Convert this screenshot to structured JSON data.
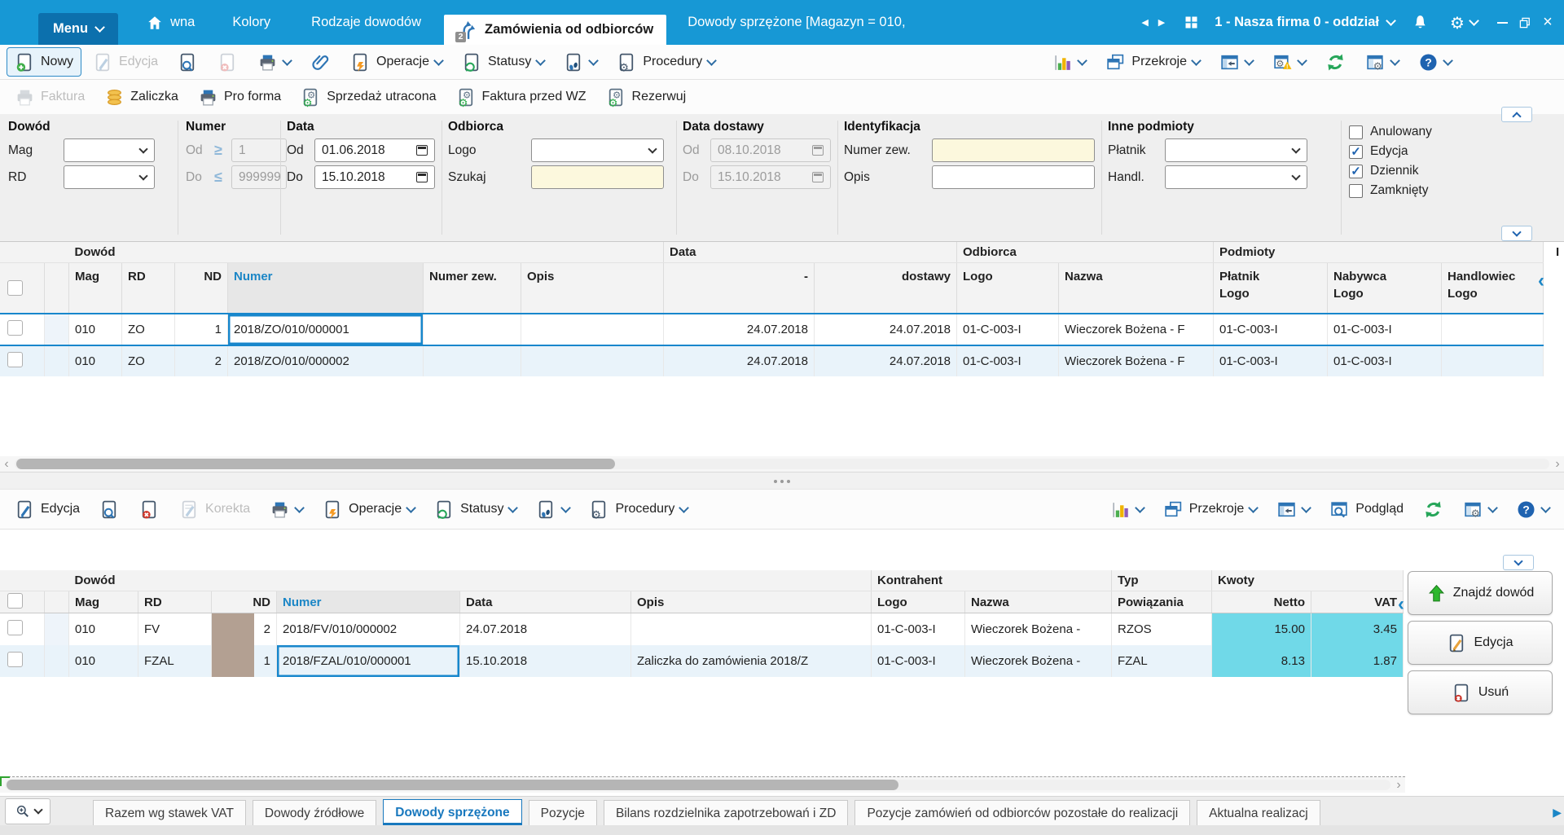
{
  "colors": {
    "topbar": "#1798d5",
    "menu_button": "#0c70ad",
    "accent_blue": "#1b86c6",
    "selection": "#1887cc",
    "cyan_cell": "#70d9e8",
    "nd_swatch": "#b3a092",
    "input_yellow": "#fcf8dd",
    "green": "#27a65a"
  },
  "topbar": {
    "menu": "Menu",
    "home_tab": "wna",
    "tabs": [
      "Kolory",
      "Rodzaje dowodów"
    ],
    "active_tab": {
      "label": "Zamówienia od odbiorców",
      "badge": "2"
    },
    "next_tab": "Dowody sprzężone [Magazyn = 010,",
    "company": "1 - Nasza firma 0 - oddział"
  },
  "toolbar_main": {
    "left": [
      {
        "id": "nowy",
        "label": "Nowy",
        "icon": "doc-plus",
        "state": "focused"
      },
      {
        "id": "edycja",
        "label": "Edycja",
        "icon": "doc-pencil-gray",
        "state": "disabled"
      },
      {
        "id": "szukaj",
        "icon": "doc-search"
      },
      {
        "id": "usun",
        "icon": "doc-x-gray",
        "state": "disabled"
      },
      {
        "id": "drukuj",
        "icon": "printer",
        "chevron": true
      },
      {
        "id": "zalaczniki",
        "icon": "paperclip"
      },
      {
        "id": "operacje",
        "label": "Operacje",
        "icon": "doc-lightning",
        "chevron": true
      },
      {
        "id": "statusy",
        "label": "Statusy",
        "icon": "doc-refresh",
        "chevron": true
      },
      {
        "id": "slady",
        "icon": "doc-steps",
        "chevron": true
      },
      {
        "id": "procedury",
        "label": "Procedury",
        "icon": "doc-gear",
        "chevron": true
      }
    ],
    "right": [
      {
        "id": "wykresy",
        "icon": "chart",
        "chevron": true
      },
      {
        "id": "przekroje",
        "label": "Przekroje",
        "icon": "windows",
        "chevron": true
      },
      {
        "id": "panel-boczny",
        "icon": "panel-left",
        "chevron": true
      },
      {
        "id": "ustawienia-ostrzezenia",
        "icon": "window-gear-warn",
        "chevron": true
      },
      {
        "id": "odswiez",
        "icon": "refresh"
      },
      {
        "id": "widok-okna",
        "icon": "window-config",
        "chevron": true
      },
      {
        "id": "pomoc",
        "icon": "help",
        "chevron": true
      }
    ]
  },
  "toolbar_ops": [
    {
      "id": "faktura",
      "label": "Faktura",
      "icon": "printer-gray",
      "state": "disabled"
    },
    {
      "id": "zaliczka",
      "label": "Zaliczka",
      "icon": "coins"
    },
    {
      "id": "pro-forma",
      "label": "Pro forma",
      "icon": "printer"
    },
    {
      "id": "sprzedaz-utracona",
      "label": "Sprzedaż utracona",
      "icon": "doc-gear-green"
    },
    {
      "id": "faktura-przed-wz",
      "label": "Faktura przed WZ",
      "icon": "doc-gear-green"
    },
    {
      "id": "rezerwuj",
      "label": "Rezerwuj",
      "icon": "doc-gear-green"
    }
  ],
  "toolbar_lower": {
    "left": [
      {
        "id": "edycja-dolna",
        "label": "Edycja",
        "icon": "doc-pencil-blue"
      },
      {
        "id": "szukaj-dolny",
        "icon": "doc-search"
      },
      {
        "id": "usun-dolny",
        "icon": "doc-x-red"
      },
      {
        "id": "korekta",
        "label": "Korekta",
        "icon": "doc-lines-gray",
        "state": "disabled"
      },
      {
        "id": "drukuj-dolny",
        "icon": "printer",
        "chevron": true
      },
      {
        "id": "operacje-dolne",
        "label": "Operacje",
        "icon": "doc-lightning",
        "chevron": true
      },
      {
        "id": "statusy-dolne",
        "label": "Statusy",
        "icon": "doc-refresh",
        "chevron": true
      },
      {
        "id": "slady-dolne",
        "icon": "doc-steps",
        "chevron": true
      },
      {
        "id": "procedury-dolne",
        "label": "Procedury",
        "icon": "doc-gear",
        "chevron": true
      }
    ],
    "right": [
      {
        "id": "wykresy-dolne",
        "icon": "chart",
        "chevron": true
      },
      {
        "id": "przekroje-dolne",
        "label": "Przekroje",
        "icon": "windows",
        "chevron": true
      },
      {
        "id": "panel-dolny",
        "icon": "panel-left",
        "chevron": true
      },
      {
        "id": "podglad",
        "label": "Podgląd",
        "icon": "window-search"
      },
      {
        "id": "odswiez-dolny",
        "icon": "refresh"
      },
      {
        "id": "widok-dolny",
        "icon": "window-config",
        "chevron": true
      },
      {
        "id": "pomoc-dolna",
        "icon": "help",
        "chevron": true
      }
    ]
  },
  "filters": {
    "dowod": {
      "title": "Dowód",
      "mag_label": "Mag",
      "rd_label": "RD",
      "mag_value": "",
      "rd_value": ""
    },
    "numer": {
      "title": "Numer",
      "od_label": "Od",
      "do_label": "Do",
      "ge": "≥",
      "le": "≤",
      "od_value": "1",
      "do_value": "999999"
    },
    "data": {
      "title": "Data",
      "od_label": "Od",
      "do_label": "Do",
      "od_value": "01.06.2018",
      "do_value": "15.10.2018"
    },
    "odbiorca": {
      "title": "Odbiorca",
      "logo_label": "Logo",
      "szukaj_label": "Szukaj",
      "logo_value": "",
      "szukaj_value": ""
    },
    "data_dostawy": {
      "title": "Data dostawy",
      "od_label": "Od",
      "do_label": "Do",
      "od_value": "08.10.2018",
      "do_value": "15.10.2018"
    },
    "identyfikacja": {
      "title": "Identyfikacja",
      "numer_zew_label": "Numer zew.",
      "opis_label": "Opis",
      "numer_zew_value": "",
      "opis_value": ""
    },
    "inne_podmioty": {
      "title": "Inne podmioty",
      "platnik_label": "Płatnik",
      "handl_label": "Handl.",
      "platnik_value": "",
      "handl_value": ""
    },
    "checkboxes": [
      {
        "label": "Anulowany",
        "checked": false
      },
      {
        "label": "Edycja",
        "checked": true
      },
      {
        "label": "Dziennik",
        "checked": true
      },
      {
        "label": "Zamknięty",
        "checked": false
      }
    ]
  },
  "upper_grid": {
    "groups": [
      "Dowód",
      "Data",
      "Odbiorca",
      "Podmioty"
    ],
    "clipped_group": "I",
    "columns": [
      {
        "l1": "Mag"
      },
      {
        "l1": "RD"
      },
      {
        "l1": "ND"
      },
      {
        "l1": "Numer"
      },
      {
        "l1": "Numer zew."
      },
      {
        "l1": "Opis"
      },
      {
        "l1": "-"
      },
      {
        "l1": "dostawy"
      },
      {
        "l1": "Logo"
      },
      {
        "l1": "Nazwa"
      },
      {
        "l1": "Płatnik",
        "l2": "Logo"
      },
      {
        "l1": "Nabywca",
        "l2": "Logo"
      },
      {
        "l1": "Handlowiec",
        "l2": "Logo"
      }
    ],
    "rows": [
      {
        "selected": true,
        "focus_col": 3,
        "cells": [
          "010",
          "ZO",
          "1",
          "2018/ZO/010/000001",
          "",
          "",
          "24.07.2018",
          "24.07.2018",
          "01-C-003-I",
          "Wieczorek Bożena - F",
          "01-C-003-I",
          "01-C-003-I",
          ""
        ]
      },
      {
        "alt": true,
        "cells": [
          "010",
          "ZO",
          "2",
          "2018/ZO/010/000002",
          "",
          "",
          "24.07.2018",
          "24.07.2018",
          "01-C-003-I",
          "Wieczorek Bożena - F",
          "01-C-003-I",
          "01-C-003-I",
          ""
        ]
      }
    ]
  },
  "lower_grid": {
    "groups": [
      "Dowód",
      "Kontrahent",
      "Typ",
      "Kwoty"
    ],
    "columns": [
      {
        "l1": "Mag"
      },
      {
        "l1": "RD"
      },
      {
        "l1": "ND"
      },
      {
        "l1": "Numer"
      },
      {
        "l1": "Data"
      },
      {
        "l1": "Opis"
      },
      {
        "l1": "Logo"
      },
      {
        "l1": "Nazwa"
      },
      {
        "l1": "Powiązania"
      },
      {
        "l1": "Netto"
      },
      {
        "l1": "VAT"
      }
    ],
    "rows": [
      {
        "cells": [
          "010",
          "FV",
          "2",
          "2018/FV/010/000002",
          "24.07.2018",
          "",
          "01-C-003-I",
          "Wieczorek Bożena - ",
          "RZOS",
          "15.00",
          "3.45"
        ]
      },
      {
        "alt": true,
        "focus_col": 3,
        "cells": [
          "010",
          "FZAL",
          "1",
          "2018/FZAL/010/000001",
          "15.10.2018",
          "Zaliczka do zamówienia 2018/Z",
          "01-C-003-I",
          "Wieczorek Bożena - ",
          "FZAL",
          "8.13",
          "1.87"
        ]
      }
    ]
  },
  "side_buttons": [
    {
      "id": "znajdz-dowod",
      "label": "Znajdź dowód",
      "icon": "arrow-up-green"
    },
    {
      "id": "edycja-boczna",
      "label": "Edycja",
      "icon": "doc-pencil-orange"
    },
    {
      "id": "usun-boczny",
      "label": "Usuń",
      "icon": "doc-x-red-star"
    }
  ],
  "bottom_tabs": [
    {
      "label": "Razem wg stawek VAT"
    },
    {
      "label": "Dowody źródłowe"
    },
    {
      "label": "Dowody sprzężone",
      "active": true
    },
    {
      "label": "Pozycje"
    },
    {
      "label": "Bilans rozdzielnika zapotrzebowań i ZD"
    },
    {
      "label": "Pozycje zamówień od odbiorców pozostałe do realizacji"
    },
    {
      "label": "Aktualna realizacj",
      "clipped": true
    }
  ]
}
